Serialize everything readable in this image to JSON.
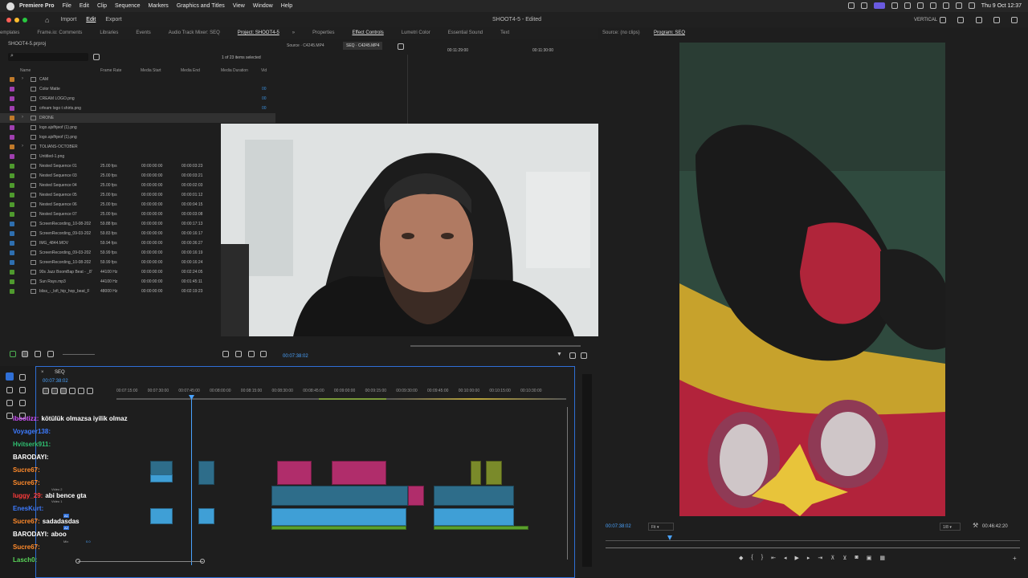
{
  "menubar": {
    "app": "Premiere Pro",
    "items": [
      "File",
      "Edit",
      "Clip",
      "Sequence",
      "Markers",
      "Graphics and Titles",
      "View",
      "Window",
      "Help"
    ],
    "clock": "Thu 9 Oct  12:37"
  },
  "titlebar": {
    "home": "",
    "import": "Import",
    "edit": "Edit",
    "export": "Export",
    "title": "SHOOT4-5 - Edited",
    "vertical": "VERTICAL"
  },
  "left_tabs": [
    "emplates",
    "Frame.io: Comments",
    "Libraries",
    "Events",
    "Audio Track Mixer: SEQ",
    "Project: SHOOT4-5"
  ],
  "right_tabs": [
    "Properties",
    "Effect Controls",
    "Lumetri Color",
    "Essential Sound",
    "Text"
  ],
  "program_tabs": {
    "source": "Source: (no clips)",
    "program": "Program: SEQ"
  },
  "project": {
    "filename": "SHOOT4-5.prproj",
    "items_selected": "1 of 23 items selected",
    "columns": [
      "Name",
      "Frame Rate",
      "Media Start",
      "Media End",
      "Media Duration",
      "Vid"
    ],
    "rows": [
      {
        "name": "CAM",
        "fr": "",
        "ms": "",
        "me": "",
        "dur": "",
        "color": "#c07a2a",
        "folder": true
      },
      {
        "name": "Color Matte",
        "fr": "",
        "ms": "",
        "me": "",
        "dur": "",
        "color": "#a03fb0",
        "vid": "00"
      },
      {
        "name": "CREAM LOGO.png",
        "fr": "",
        "ms": "",
        "me": "",
        "dur": "",
        "color": "#a03fb0",
        "vid": "00"
      },
      {
        "name": "crfeam logo t shirts.png",
        "fr": "",
        "ms": "",
        "me": "",
        "dur": "",
        "color": "#a03fb0",
        "vid": "00"
      },
      {
        "name": "DRONE",
        "fr": "",
        "ms": "",
        "me": "",
        "dur": "",
        "color": "#c07a2a",
        "folder": true
      },
      {
        "name": "logo.ajsfhjeof (1).png",
        "fr": "",
        "ms": "",
        "me": "",
        "dur": "",
        "color": "#a03fb0"
      },
      {
        "name": "logo.ajsfhjeof (1).png",
        "fr": "",
        "ms": "",
        "me": "",
        "dur": "",
        "color": "#a03fb0"
      },
      {
        "name": "TOLIANS-OCTOBER",
        "fr": "",
        "ms": "",
        "me": "",
        "dur": "",
        "color": "#c07a2a",
        "folder": true
      },
      {
        "name": "Untitled-1.png",
        "fr": "",
        "ms": "",
        "me": "",
        "dur": "",
        "color": "#a03fb0"
      },
      {
        "name": "Nested Sequence 01",
        "fr": "25.00 fps",
        "ms": "00:00:00:00",
        "me": "",
        "dur": "00:00:03:23",
        "color": "#4f9a2e"
      },
      {
        "name": "Nested Sequence 03",
        "fr": "25.00 fps",
        "ms": "00:00:00:00",
        "me": "",
        "dur": "00:00:03:21",
        "color": "#4f9a2e"
      },
      {
        "name": "Nested Sequence 04",
        "fr": "25.00 fps",
        "ms": "00:00:00:00",
        "me": "",
        "dur": "00:00:02:03",
        "color": "#4f9a2e"
      },
      {
        "name": "Nested Sequence 05",
        "fr": "25.00 fps",
        "ms": "00:00:00:00",
        "me": "",
        "dur": "00:00:01:12",
        "color": "#4f9a2e"
      },
      {
        "name": "Nested Sequence 06",
        "fr": "25.00 fps",
        "ms": "00:00:00:00",
        "me": "",
        "dur": "00:00:04:15",
        "color": "#4f9a2e"
      },
      {
        "name": "Nested Sequence 07",
        "fr": "25.00 fps",
        "ms": "00:00:00:00",
        "me": "",
        "dur": "00:00:03:08",
        "color": "#4f9a2e"
      },
      {
        "name": "ScreenRecording_10-08-202",
        "fr": "59.88 fps",
        "ms": "00:00:00:00",
        "me": "",
        "dur": "00:00:17:13",
        "color": "#2e6fb0"
      },
      {
        "name": "ScreenRecording_09-03-202",
        "fr": "59.83 fps",
        "ms": "00:00:00:00",
        "me": "",
        "dur": "00:00:16:17",
        "color": "#2e6fb0"
      },
      {
        "name": "IMG_4844.MOV",
        "fr": "59.94 fps",
        "ms": "00:00:00:00",
        "me": "",
        "dur": "00:00:36:27",
        "color": "#2e6fb0"
      },
      {
        "name": "ScreenRecording_09-03-202",
        "fr": "59.99 fps",
        "ms": "00:00:00:00",
        "me": "",
        "dur": "00:00:16:19",
        "color": "#2e6fb0"
      },
      {
        "name": "ScreenRecording_10-08-202",
        "fr": "59.99 fps",
        "ms": "00:00:00:00",
        "me": "",
        "dur": "00:00:16:24",
        "color": "#2e6fb0"
      },
      {
        "name": "90s Jazz BoomBap Beat - _8'",
        "fr": "44100 Hz",
        "ms": "00:00:00:00",
        "me": "",
        "dur": "00:02:24:05",
        "color": "#4f9a2e"
      },
      {
        "name": "Sun Rays.mp3",
        "fr": "44100 Hz",
        "ms": "00:00:00:00",
        "me": "",
        "dur": "00:01:45:11",
        "color": "#4f9a2e"
      },
      {
        "name": "bliss_-_lofi_hip_hop_beat_F",
        "fr": "48000 Hz",
        "ms": "00:00:00:00",
        "me": "",
        "dur": "00:02:19:23",
        "color": "#4f9a2e"
      }
    ]
  },
  "effect_controls": {
    "source": "Source · C4245.MP4",
    "seq": "SEQ · C4245.MP4",
    "tc1": "00:11:29:00",
    "tc2": "00:11:30:00",
    "timecode": "00:07:38:02"
  },
  "program": {
    "timecode": "00:07:38:02",
    "fit": "Fit",
    "res": "1/8",
    "duration": "00:46:42:20"
  },
  "timeline": {
    "seq": "SEQ",
    "timecode": "00:07:38:02",
    "ruler": [
      "00:07:15:00",
      "00:07:30:00",
      "00:07:45:00",
      "00:08:00:00",
      "00:08:15:00",
      "00:08:30:00",
      "00:08:45:00",
      "00:09:00:00",
      "00:09:15:00",
      "00:09:30:00",
      "00:09:45:00",
      "00:10:00:00",
      "00:10:15:00",
      "00:10:30:00"
    ],
    "track_labels": [
      "Video 2",
      "Video 1",
      "A1",
      "A2",
      "Mix",
      "0.0"
    ]
  },
  "chat": [
    {
      "user": "ibootizz:",
      "msg": "kötülük olmazsa iyilik olmaz",
      "color": "#d04fff"
    },
    {
      "user": "Voyager138:",
      "msg": "",
      "color": "#3d7bff"
    },
    {
      "user": "Hvitserk911:",
      "msg": "",
      "color": "#2fbf71"
    },
    {
      "user": "BARODAYI:",
      "msg": "",
      "color": "#ffffff"
    },
    {
      "user": "Sucre67:",
      "msg": "",
      "color": "#ff8a2b"
    },
    {
      "user": "Sucre67:",
      "msg": "",
      "color": "#ff8a2b"
    },
    {
      "user": "luggy_29:",
      "msg": "abi bence gta",
      "color": "#ff3b3b"
    },
    {
      "user": "EnesKurt:",
      "msg": "",
      "color": "#3d7bff"
    },
    {
      "user": "Sucre67:",
      "msg": "sadadasdas",
      "color": "#ff8a2b"
    },
    {
      "user": "BARODAYI:",
      "msg": "aboo",
      "color": "#ffffff"
    },
    {
      "user": "Sucre67:",
      "msg": "",
      "color": "#ff8a2b"
    },
    {
      "user": "Lasch0:",
      "msg": "",
      "color": "#59d659"
    }
  ],
  "colors": {
    "accent": "#3b8fdc",
    "playhead": "#4aa3ff",
    "clip_video": "#2e6d8a",
    "clip_pink": "#b02d6b",
    "audio": "#3f9fd6"
  }
}
